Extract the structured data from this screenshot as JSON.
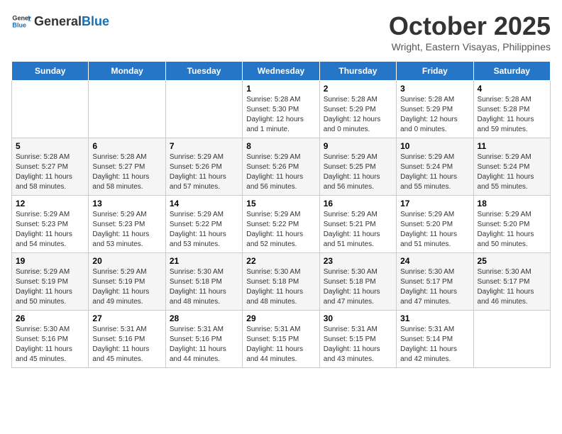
{
  "header": {
    "logo_general": "General",
    "logo_blue": "Blue",
    "month_title": "October 2025",
    "location": "Wright, Eastern Visayas, Philippines"
  },
  "days_of_week": [
    "Sunday",
    "Monday",
    "Tuesday",
    "Wednesday",
    "Thursday",
    "Friday",
    "Saturday"
  ],
  "weeks": [
    [
      {
        "day": "",
        "info": ""
      },
      {
        "day": "",
        "info": ""
      },
      {
        "day": "",
        "info": ""
      },
      {
        "day": "1",
        "info": "Sunrise: 5:28 AM\nSunset: 5:30 PM\nDaylight: 12 hours\nand 1 minute."
      },
      {
        "day": "2",
        "info": "Sunrise: 5:28 AM\nSunset: 5:29 PM\nDaylight: 12 hours\nand 0 minutes."
      },
      {
        "day": "3",
        "info": "Sunrise: 5:28 AM\nSunset: 5:29 PM\nDaylight: 12 hours\nand 0 minutes."
      },
      {
        "day": "4",
        "info": "Sunrise: 5:28 AM\nSunset: 5:28 PM\nDaylight: 11 hours\nand 59 minutes."
      }
    ],
    [
      {
        "day": "5",
        "info": "Sunrise: 5:28 AM\nSunset: 5:27 PM\nDaylight: 11 hours\nand 58 minutes."
      },
      {
        "day": "6",
        "info": "Sunrise: 5:28 AM\nSunset: 5:27 PM\nDaylight: 11 hours\nand 58 minutes."
      },
      {
        "day": "7",
        "info": "Sunrise: 5:29 AM\nSunset: 5:26 PM\nDaylight: 11 hours\nand 57 minutes."
      },
      {
        "day": "8",
        "info": "Sunrise: 5:29 AM\nSunset: 5:26 PM\nDaylight: 11 hours\nand 56 minutes."
      },
      {
        "day": "9",
        "info": "Sunrise: 5:29 AM\nSunset: 5:25 PM\nDaylight: 11 hours\nand 56 minutes."
      },
      {
        "day": "10",
        "info": "Sunrise: 5:29 AM\nSunset: 5:24 PM\nDaylight: 11 hours\nand 55 minutes."
      },
      {
        "day": "11",
        "info": "Sunrise: 5:29 AM\nSunset: 5:24 PM\nDaylight: 11 hours\nand 55 minutes."
      }
    ],
    [
      {
        "day": "12",
        "info": "Sunrise: 5:29 AM\nSunset: 5:23 PM\nDaylight: 11 hours\nand 54 minutes."
      },
      {
        "day": "13",
        "info": "Sunrise: 5:29 AM\nSunset: 5:23 PM\nDaylight: 11 hours\nand 53 minutes."
      },
      {
        "day": "14",
        "info": "Sunrise: 5:29 AM\nSunset: 5:22 PM\nDaylight: 11 hours\nand 53 minutes."
      },
      {
        "day": "15",
        "info": "Sunrise: 5:29 AM\nSunset: 5:22 PM\nDaylight: 11 hours\nand 52 minutes."
      },
      {
        "day": "16",
        "info": "Sunrise: 5:29 AM\nSunset: 5:21 PM\nDaylight: 11 hours\nand 51 minutes."
      },
      {
        "day": "17",
        "info": "Sunrise: 5:29 AM\nSunset: 5:20 PM\nDaylight: 11 hours\nand 51 minutes."
      },
      {
        "day": "18",
        "info": "Sunrise: 5:29 AM\nSunset: 5:20 PM\nDaylight: 11 hours\nand 50 minutes."
      }
    ],
    [
      {
        "day": "19",
        "info": "Sunrise: 5:29 AM\nSunset: 5:19 PM\nDaylight: 11 hours\nand 50 minutes."
      },
      {
        "day": "20",
        "info": "Sunrise: 5:29 AM\nSunset: 5:19 PM\nDaylight: 11 hours\nand 49 minutes."
      },
      {
        "day": "21",
        "info": "Sunrise: 5:30 AM\nSunset: 5:18 PM\nDaylight: 11 hours\nand 48 minutes."
      },
      {
        "day": "22",
        "info": "Sunrise: 5:30 AM\nSunset: 5:18 PM\nDaylight: 11 hours\nand 48 minutes."
      },
      {
        "day": "23",
        "info": "Sunrise: 5:30 AM\nSunset: 5:18 PM\nDaylight: 11 hours\nand 47 minutes."
      },
      {
        "day": "24",
        "info": "Sunrise: 5:30 AM\nSunset: 5:17 PM\nDaylight: 11 hours\nand 47 minutes."
      },
      {
        "day": "25",
        "info": "Sunrise: 5:30 AM\nSunset: 5:17 PM\nDaylight: 11 hours\nand 46 minutes."
      }
    ],
    [
      {
        "day": "26",
        "info": "Sunrise: 5:30 AM\nSunset: 5:16 PM\nDaylight: 11 hours\nand 45 minutes."
      },
      {
        "day": "27",
        "info": "Sunrise: 5:31 AM\nSunset: 5:16 PM\nDaylight: 11 hours\nand 45 minutes."
      },
      {
        "day": "28",
        "info": "Sunrise: 5:31 AM\nSunset: 5:16 PM\nDaylight: 11 hours\nand 44 minutes."
      },
      {
        "day": "29",
        "info": "Sunrise: 5:31 AM\nSunset: 5:15 PM\nDaylight: 11 hours\nand 44 minutes."
      },
      {
        "day": "30",
        "info": "Sunrise: 5:31 AM\nSunset: 5:15 PM\nDaylight: 11 hours\nand 43 minutes."
      },
      {
        "day": "31",
        "info": "Sunrise: 5:31 AM\nSunset: 5:14 PM\nDaylight: 11 hours\nand 42 minutes."
      },
      {
        "day": "",
        "info": ""
      }
    ]
  ]
}
